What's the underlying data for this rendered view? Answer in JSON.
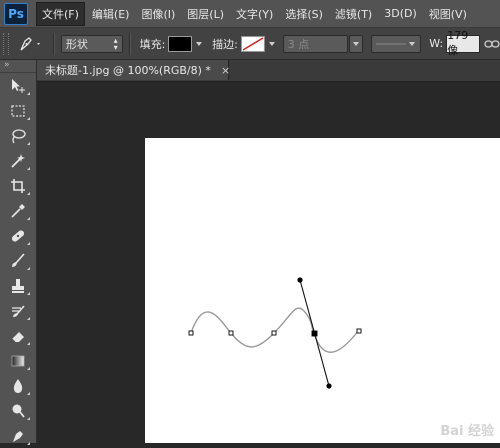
{
  "app": {
    "logo": "Ps",
    "menus": [
      "文件(F)",
      "编辑(E)",
      "图像(I)",
      "图层(L)",
      "文字(Y)",
      "选择(S)",
      "滤镜(T)",
      "3D(D)",
      "视图(V)"
    ]
  },
  "options": {
    "mode_value": "形状",
    "fill_label": "填充:",
    "fill_color": "#000000",
    "stroke_label": "描边:",
    "stroke_width": "3 点",
    "w_label": "W:",
    "w_value": "179 像"
  },
  "document": {
    "tab_title": "未标题-1.jpg @ 100%(RGB/8) *",
    "close_glyph": "×",
    "watermark": "Bai 经验"
  },
  "tools": [
    "move-tool-icon",
    "marquee-tool-icon",
    "lasso-tool-icon",
    "magic-wand-tool-icon",
    "crop-tool-icon",
    "eyedropper-tool-icon",
    "healing-brush-tool-icon",
    "brush-tool-icon",
    "clone-stamp-tool-icon",
    "history-brush-tool-icon",
    "eraser-tool-icon",
    "gradient-tool-icon",
    "blur-tool-icon",
    "dodge-tool-icon",
    "pen-tool-icon"
  ],
  "colors": {
    "menubar_bg": "#535353",
    "workspace_bg": "#282828",
    "canvas_bg": "#ffffff",
    "path_stroke": "#9a9a9a",
    "anchor_color": "#000000"
  }
}
